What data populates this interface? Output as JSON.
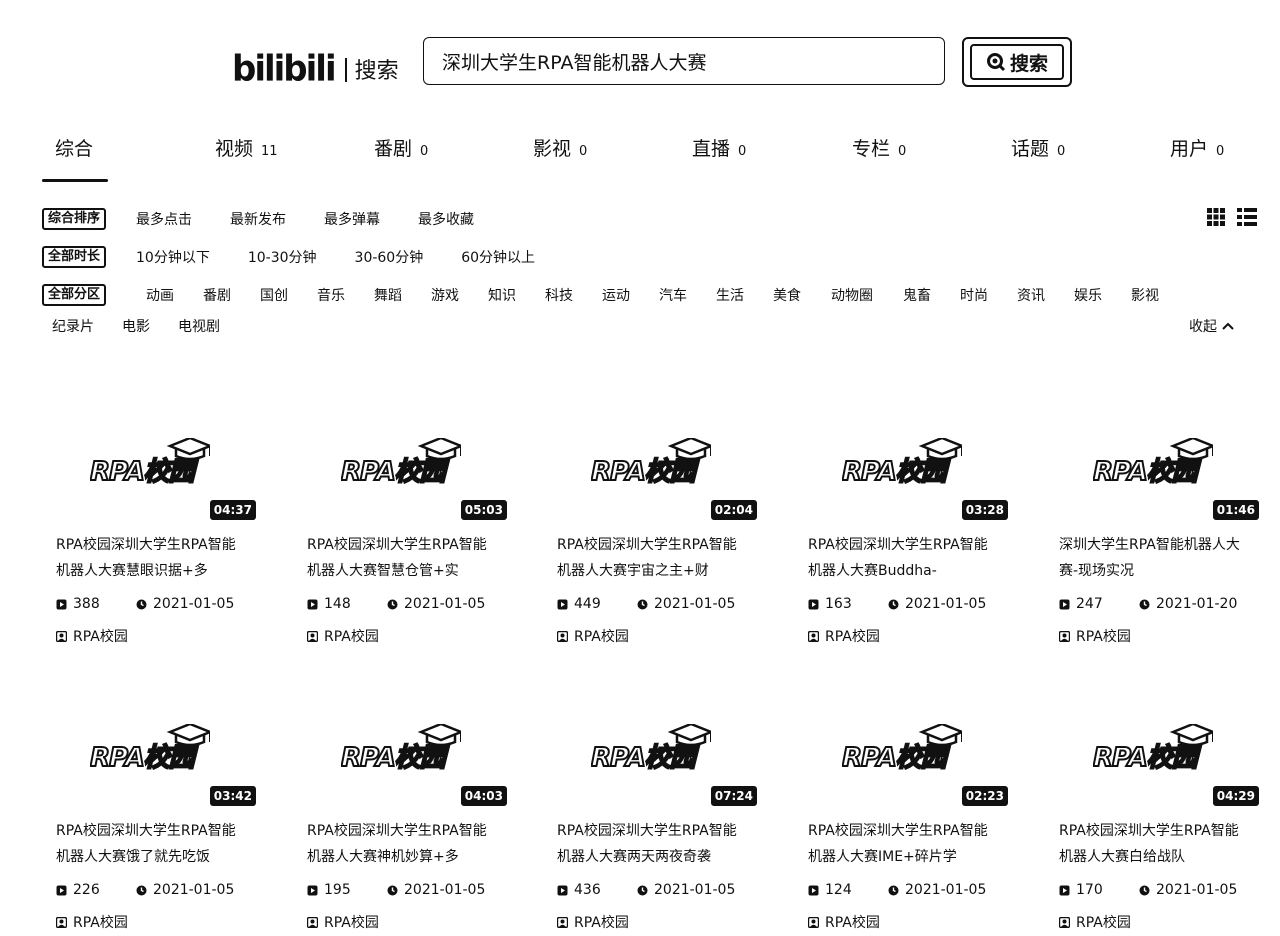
{
  "header": {
    "logo_text": "bilibili",
    "logo_sub": "搜索",
    "search_value": "深圳大学生RPA智能机器人大赛",
    "search_button": "搜索"
  },
  "tabs": [
    {
      "label": "综合",
      "count": ""
    },
    {
      "label": "视频",
      "count": "11"
    },
    {
      "label": "番剧",
      "count": "0"
    },
    {
      "label": "影视",
      "count": "0"
    },
    {
      "label": "直播",
      "count": "0"
    },
    {
      "label": "专栏",
      "count": "0"
    },
    {
      "label": "话题",
      "count": "0"
    },
    {
      "label": "用户",
      "count": "0"
    }
  ],
  "sort": {
    "active": "综合排序",
    "options": [
      "最多点击",
      "最新发布",
      "最多弹幕",
      "最多收藏"
    ]
  },
  "duration": {
    "active": "全部时长",
    "options": [
      "10分钟以下",
      "10-30分钟",
      "30-60分钟",
      "60分钟以上"
    ]
  },
  "zone": {
    "active": "全部分区",
    "options": [
      "动画",
      "番剧",
      "国创",
      "音乐",
      "舞蹈",
      "游戏",
      "知识",
      "科技",
      "运动",
      "汽车",
      "生活",
      "美食",
      "动物圈",
      "鬼畜",
      "时尚",
      "资讯",
      "娱乐",
      "影视"
    ],
    "options_row2": [
      "纪录片",
      "电影",
      "电视剧"
    ],
    "collapse": "收起"
  },
  "thumb_logo": "RPA校园",
  "videos": [
    {
      "duration": "04:37",
      "title": "RPA校园深圳大学生RPA智能机器人大赛慧眼识据+多",
      "plays": "388",
      "date": "2021-01-05",
      "uploader": "RPA校园"
    },
    {
      "duration": "05:03",
      "title": "RPA校园深圳大学生RPA智能机器人大赛智慧仓管+实",
      "plays": "148",
      "date": "2021-01-05",
      "uploader": "RPA校园"
    },
    {
      "duration": "02:04",
      "title": "RPA校园深圳大学生RPA智能机器人大赛宇宙之主+财",
      "plays": "449",
      "date": "2021-01-05",
      "uploader": "RPA校园"
    },
    {
      "duration": "03:28",
      "title": "RPA校园深圳大学生RPA智能机器人大赛Buddha-",
      "plays": "163",
      "date": "2021-01-05",
      "uploader": "RPA校园"
    },
    {
      "duration": "01:46",
      "title": "深圳大学生RPA智能机器人大赛-现场实况",
      "plays": "247",
      "date": "2021-01-20",
      "uploader": "RPA校园"
    },
    {
      "duration": "03:42",
      "title": "RPA校园深圳大学生RPA智能机器人大赛饿了就先吃饭",
      "plays": "226",
      "date": "2021-01-05",
      "uploader": "RPA校园"
    },
    {
      "duration": "04:03",
      "title": "RPA校园深圳大学生RPA智能机器人大赛神机妙算+多",
      "plays": "195",
      "date": "2021-01-05",
      "uploader": "RPA校园"
    },
    {
      "duration": "07:24",
      "title": "RPA校园深圳大学生RPA智能机器人大赛两天两夜奇袭",
      "plays": "436",
      "date": "2021-01-05",
      "uploader": "RPA校园"
    },
    {
      "duration": "02:23",
      "title": "RPA校园深圳大学生RPA智能机器人大赛IME+碎片学",
      "plays": "124",
      "date": "2021-01-05",
      "uploader": "RPA校园"
    },
    {
      "duration": "04:29",
      "title": "RPA校园深圳大学生RPA智能机器人大赛白给战队",
      "plays": "170",
      "date": "2021-01-05",
      "uploader": "RPA校园"
    }
  ]
}
